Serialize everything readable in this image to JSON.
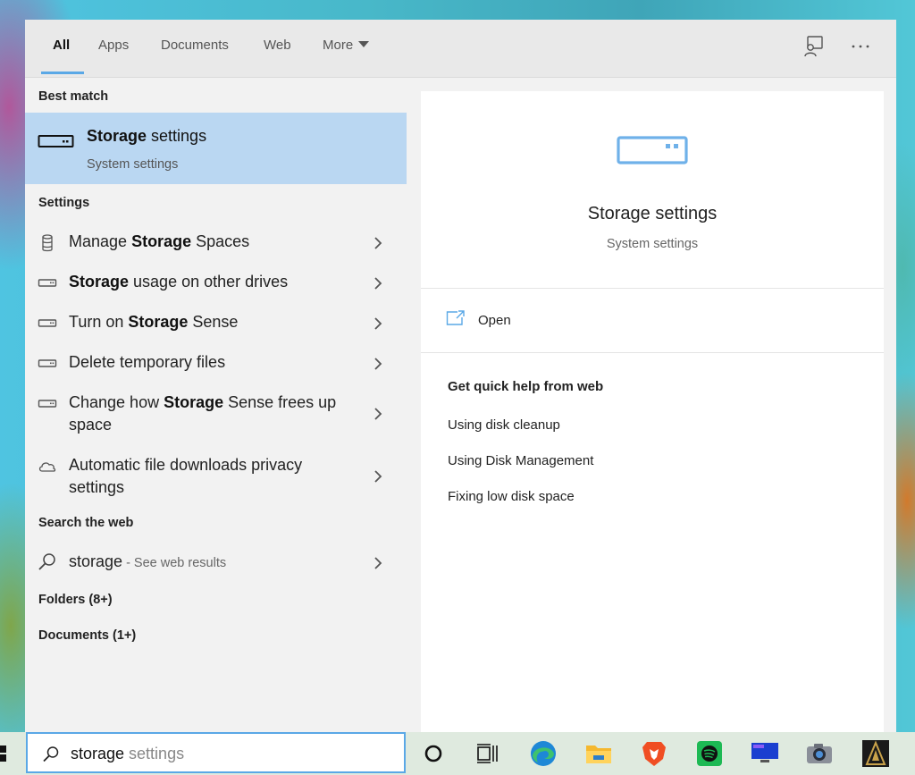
{
  "tabs": [
    {
      "label": "All"
    },
    {
      "label": "Apps"
    },
    {
      "label": "Documents"
    },
    {
      "label": "Web"
    },
    {
      "label": "More"
    }
  ],
  "best_match": {
    "header": "Best match",
    "title_bold": "Storage",
    "title_rest": " settings",
    "subtitle": "System settings",
    "icon": "drive-icon"
  },
  "settings": {
    "header": "Settings",
    "items": [
      {
        "pre": "Manage ",
        "bold": "Storage",
        "post": " Spaces",
        "icon": "storage-spaces-icon"
      },
      {
        "pre": "",
        "bold": "Storage",
        "post": " usage on other drives",
        "icon": "drive-icon"
      },
      {
        "pre": "Turn on ",
        "bold": "Storage",
        "post": " Sense",
        "icon": "drive-icon"
      },
      {
        "pre": "Delete temporary files",
        "bold": "",
        "post": "",
        "icon": "drive-icon"
      },
      {
        "pre": "Change how ",
        "bold": "Storage",
        "post": " Sense frees up space",
        "icon": "drive-icon"
      },
      {
        "pre": "Automatic file downloads privacy settings",
        "bold": "",
        "post": "",
        "icon": "cloud-icon"
      }
    ]
  },
  "web": {
    "header": "Search the web",
    "query": "storage",
    "suffix": " - See web results"
  },
  "folders_header": "Folders (8+)",
  "documents_header": "Documents (1+)",
  "preview": {
    "title": "Storage settings",
    "subtitle": "System settings",
    "open_label": "Open",
    "help_title": "Get quick help from web",
    "links": [
      "Using disk cleanup",
      "Using Disk Management",
      "Fixing low disk space"
    ]
  },
  "taskbar": {
    "typed": "storage",
    "suggestion": " settings",
    "apps": [
      "cortana-icon",
      "task-view-icon",
      "edge-icon",
      "file-explorer-icon",
      "brave-icon",
      "spotify-icon",
      "monitor-icon",
      "camera-icon",
      "game-icon"
    ]
  },
  "colors": {
    "accent": "#5aa8e6",
    "selection": "#bad7f2",
    "drive_icon": "#6fb1e9"
  }
}
